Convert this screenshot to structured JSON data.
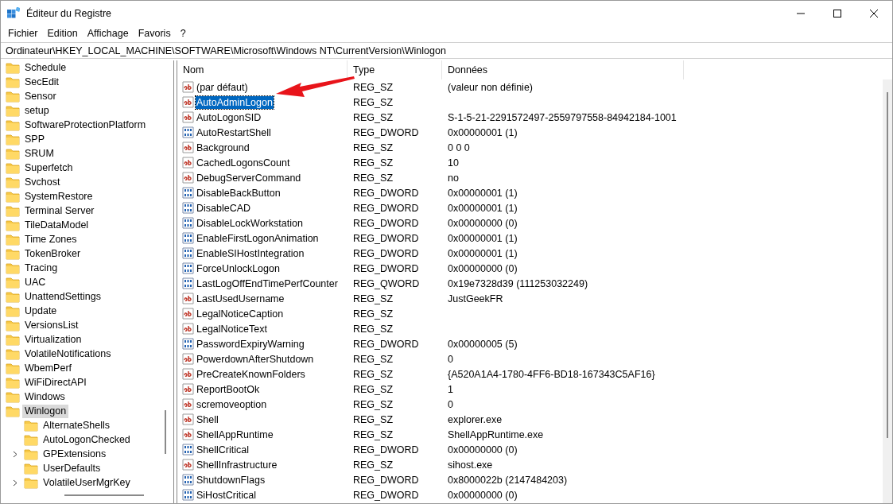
{
  "window": {
    "title": "Éditeur du Registre"
  },
  "menu": [
    "Fichier",
    "Edition",
    "Affichage",
    "Favoris",
    "?"
  ],
  "address": "Ordinateur\\HKEY_LOCAL_MACHINE\\SOFTWARE\\Microsoft\\Windows NT\\CurrentVersion\\Winlogon",
  "tree": [
    {
      "label": "Schedule",
      "selected": false
    },
    {
      "label": "SecEdit",
      "selected": false
    },
    {
      "label": "Sensor",
      "selected": false
    },
    {
      "label": "setup",
      "selected": false
    },
    {
      "label": "SoftwareProtectionPlatform",
      "selected": false
    },
    {
      "label": "SPP",
      "selected": false
    },
    {
      "label": "SRUM",
      "selected": false
    },
    {
      "label": "Superfetch",
      "selected": false
    },
    {
      "label": "Svchost",
      "selected": false
    },
    {
      "label": "SystemRestore",
      "selected": false
    },
    {
      "label": "Terminal Server",
      "selected": false
    },
    {
      "label": "TileDataModel",
      "selected": false
    },
    {
      "label": "Time Zones",
      "selected": false
    },
    {
      "label": "TokenBroker",
      "selected": false
    },
    {
      "label": "Tracing",
      "selected": false
    },
    {
      "label": "UAC",
      "selected": false
    },
    {
      "label": "UnattendSettings",
      "selected": false
    },
    {
      "label": "Update",
      "selected": false
    },
    {
      "label": "VersionsList",
      "selected": false
    },
    {
      "label": "Virtualization",
      "selected": false
    },
    {
      "label": "VolatileNotifications",
      "selected": false
    },
    {
      "label": "WbemPerf",
      "selected": false
    },
    {
      "label": "WiFiDirectAPI",
      "selected": false
    },
    {
      "label": "Windows",
      "selected": false
    },
    {
      "label": "Winlogon",
      "selected": true,
      "children": [
        {
          "label": "AlternateShells",
          "selected": false,
          "expandable": false
        },
        {
          "label": "AutoLogonChecked",
          "selected": false,
          "expandable": false
        },
        {
          "label": "GPExtensions",
          "selected": false,
          "expandable": true
        },
        {
          "label": "UserDefaults",
          "selected": false,
          "expandable": false
        },
        {
          "label": "VolatileUserMgrKey",
          "selected": false,
          "expandable": true
        }
      ]
    }
  ],
  "table": {
    "columns": [
      "Nom",
      "Type",
      "Données"
    ],
    "rows": [
      {
        "kind": "string",
        "name": "(par défaut)",
        "type": "REG_SZ",
        "data": "(valeur non définie)",
        "selected": false
      },
      {
        "kind": "string",
        "name": "AutoAdminLogon",
        "type": "REG_SZ",
        "data": "",
        "selected": true
      },
      {
        "kind": "string",
        "name": "AutoLogonSID",
        "type": "REG_SZ",
        "data": "S-1-5-21-2291572497-2559797558-84942184-1001",
        "selected": false
      },
      {
        "kind": "binary",
        "name": "AutoRestartShell",
        "type": "REG_DWORD",
        "data": "0x00000001 (1)",
        "selected": false
      },
      {
        "kind": "string",
        "name": "Background",
        "type": "REG_SZ",
        "data": "0 0 0",
        "selected": false
      },
      {
        "kind": "string",
        "name": "CachedLogonsCount",
        "type": "REG_SZ",
        "data": "10",
        "selected": false
      },
      {
        "kind": "string",
        "name": "DebugServerCommand",
        "type": "REG_SZ",
        "data": "no",
        "selected": false
      },
      {
        "kind": "binary",
        "name": "DisableBackButton",
        "type": "REG_DWORD",
        "data": "0x00000001 (1)",
        "selected": false
      },
      {
        "kind": "binary",
        "name": "DisableCAD",
        "type": "REG_DWORD",
        "data": "0x00000001 (1)",
        "selected": false
      },
      {
        "kind": "binary",
        "name": "DisableLockWorkstation",
        "type": "REG_DWORD",
        "data": "0x00000000 (0)",
        "selected": false
      },
      {
        "kind": "binary",
        "name": "EnableFirstLogonAnimation",
        "type": "REG_DWORD",
        "data": "0x00000001 (1)",
        "selected": false
      },
      {
        "kind": "binary",
        "name": "EnableSIHostIntegration",
        "type": "REG_DWORD",
        "data": "0x00000001 (1)",
        "selected": false
      },
      {
        "kind": "binary",
        "name": "ForceUnlockLogon",
        "type": "REG_DWORD",
        "data": "0x00000000 (0)",
        "selected": false
      },
      {
        "kind": "binary",
        "name": "LastLogOffEndTimePerfCounter",
        "type": "REG_QWORD",
        "data": "0x19e7328d39 (111253032249)",
        "selected": false
      },
      {
        "kind": "string",
        "name": "LastUsedUsername",
        "type": "REG_SZ",
        "data": "JustGeekFR",
        "selected": false
      },
      {
        "kind": "string",
        "name": "LegalNoticeCaption",
        "type": "REG_SZ",
        "data": "",
        "selected": false
      },
      {
        "kind": "string",
        "name": "LegalNoticeText",
        "type": "REG_SZ",
        "data": "",
        "selected": false
      },
      {
        "kind": "binary",
        "name": "PasswordExpiryWarning",
        "type": "REG_DWORD",
        "data": "0x00000005 (5)",
        "selected": false
      },
      {
        "kind": "string",
        "name": "PowerdownAfterShutdown",
        "type": "REG_SZ",
        "data": "0",
        "selected": false
      },
      {
        "kind": "string",
        "name": "PreCreateKnownFolders",
        "type": "REG_SZ",
        "data": "{A520A1A4-1780-4FF6-BD18-167343C5AF16}",
        "selected": false
      },
      {
        "kind": "string",
        "name": "ReportBootOk",
        "type": "REG_SZ",
        "data": "1",
        "selected": false
      },
      {
        "kind": "string",
        "name": "scremoveoption",
        "type": "REG_SZ",
        "data": "0",
        "selected": false
      },
      {
        "kind": "string",
        "name": "Shell",
        "type": "REG_SZ",
        "data": "explorer.exe",
        "selected": false
      },
      {
        "kind": "string",
        "name": "ShellAppRuntime",
        "type": "REG_SZ",
        "data": "ShellAppRuntime.exe",
        "selected": false
      },
      {
        "kind": "binary",
        "name": "ShellCritical",
        "type": "REG_DWORD",
        "data": "0x00000000 (0)",
        "selected": false
      },
      {
        "kind": "string",
        "name": "ShellInfrastructure",
        "type": "REG_SZ",
        "data": "sihost.exe",
        "selected": false
      },
      {
        "kind": "binary",
        "name": "ShutdownFlags",
        "type": "REG_DWORD",
        "data": "0x8000022b (2147484203)",
        "selected": false
      },
      {
        "kind": "binary",
        "name": "SiHostCritical",
        "type": "REG_DWORD",
        "data": "0x00000000 (0)",
        "selected": false
      }
    ]
  }
}
